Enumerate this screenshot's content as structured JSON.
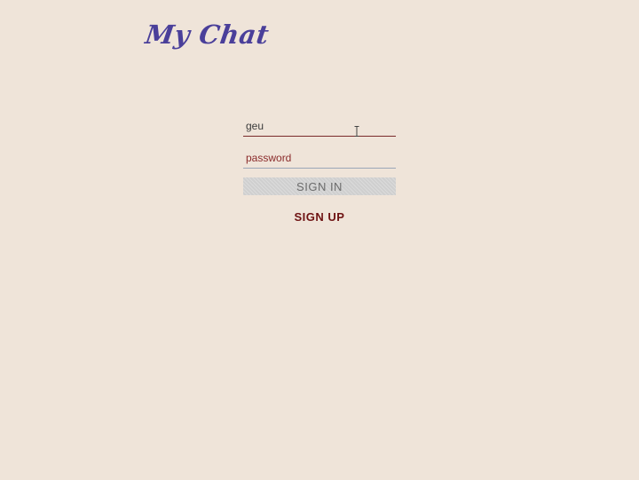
{
  "app": {
    "title": "My Chat"
  },
  "login": {
    "username_value": "geu",
    "password_placeholder": "password",
    "signin_label": "SIGN IN",
    "signup_label": "SIGN UP"
  },
  "icons": {
    "cursor": "text-cursor-icon"
  },
  "colors": {
    "background": "#efe4d9",
    "logo": "#4a3f9a",
    "accent": "#6e1212",
    "signin_button": "#cfcfcf"
  }
}
